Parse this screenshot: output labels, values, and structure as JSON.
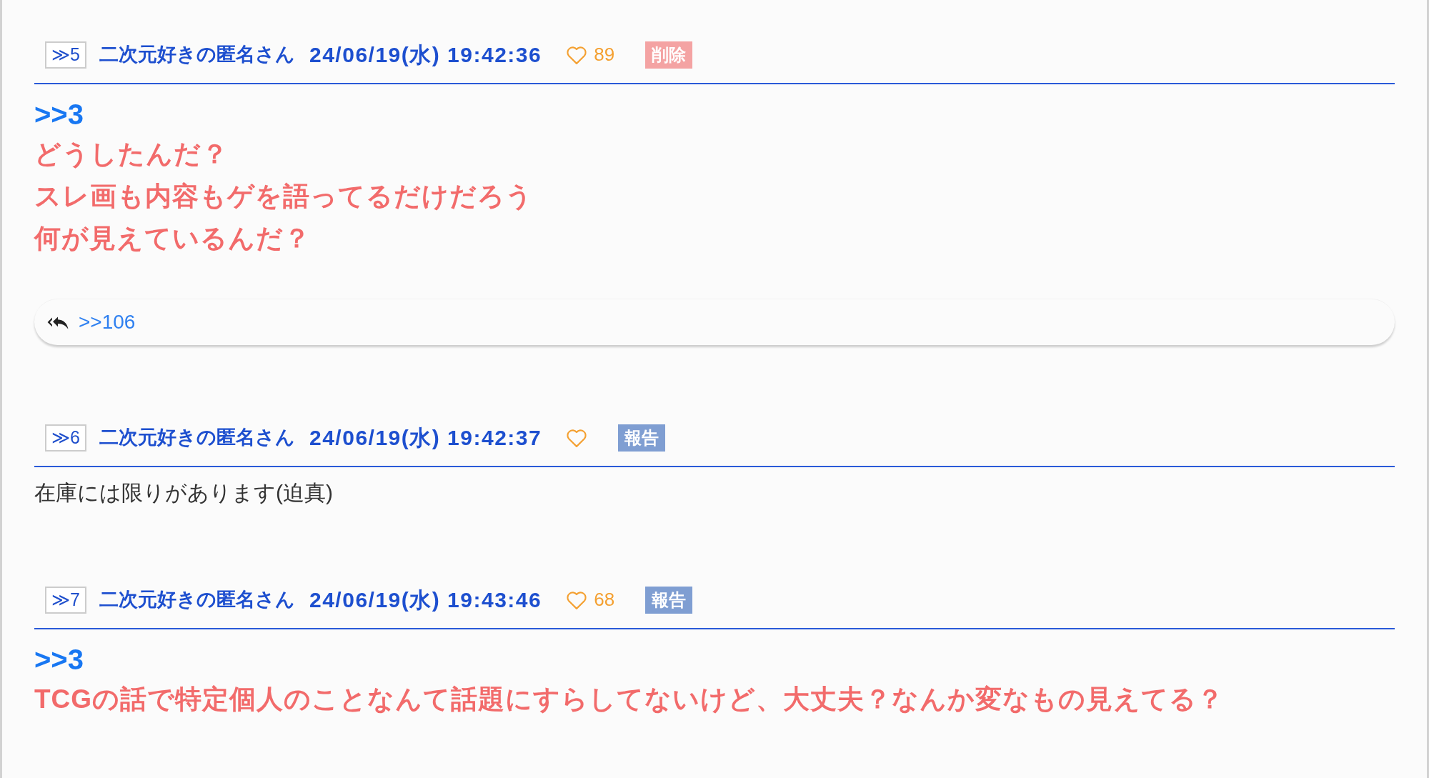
{
  "posts": [
    {
      "number": "≫5",
      "author": "二次元好きの匿名さん",
      "datetime": "24/06/19(水) 19:42:36",
      "likes": "89",
      "action": {
        "kind": "delete",
        "label": "削除"
      },
      "body": [
        {
          "kind": "anchor",
          "text": ">>3"
        },
        {
          "kind": "emphasis",
          "text": "どうしたんだ？"
        },
        {
          "kind": "emphasis",
          "text": "スレ画も内容もゲを語ってるだけだろう"
        },
        {
          "kind": "emphasis",
          "text": "何が見えているんだ？"
        }
      ],
      "replies": [
        ">>106"
      ]
    },
    {
      "number": "≫6",
      "author": "二次元好きの匿名さん",
      "datetime": "24/06/19(水) 19:42:37",
      "action": {
        "kind": "report",
        "label": "報告"
      },
      "body": [
        {
          "kind": "plain",
          "text": "在庫には限りがあります(迫真)"
        }
      ]
    },
    {
      "number": "≫7",
      "author": "二次元好きの匿名さん",
      "datetime": "24/06/19(水) 19:43:46",
      "likes": "68",
      "action": {
        "kind": "report",
        "label": "報告"
      },
      "body": [
        {
          "kind": "anchor",
          "text": ">>3"
        },
        {
          "kind": "emphasis",
          "text": "TCGの話で特定個人のことなんて話題にすらしてないけど、大丈夫？なんか変なもの見えてる？"
        }
      ]
    }
  ]
}
